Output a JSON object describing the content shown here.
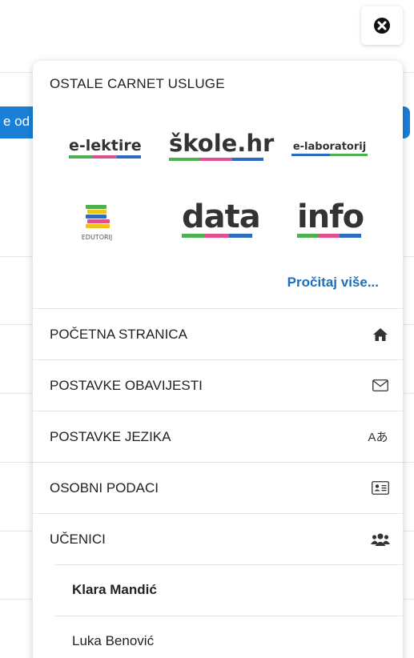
{
  "background": {
    "button_fragment": "e od"
  },
  "close_button": {
    "icon": "close-circle-icon"
  },
  "services": {
    "title": "OSTALE CARNET USLUGE",
    "logos": [
      "e-lektire",
      "škole.hr",
      "e-laboratorij",
      "EDUTORIJ",
      "data",
      "info"
    ],
    "read_more": "Pročitaj više..."
  },
  "menu": {
    "items": [
      {
        "label": "POČETNA STRANICA",
        "icon": "home-icon"
      },
      {
        "label": "POSTAVKE OBAVIJESTI",
        "icon": "envelope-icon"
      },
      {
        "label": "POSTAVKE JEZIKA",
        "icon": "translate-icon",
        "glyph": "Aあ"
      },
      {
        "label": "OSOBNI PODACI",
        "icon": "id-card-icon"
      },
      {
        "label": "UČENICI",
        "icon": "users-icon"
      }
    ]
  },
  "students": [
    {
      "name": "Klara Mandić",
      "active": true
    },
    {
      "name": "Luka Benović",
      "active": false
    }
  ],
  "colors": {
    "accent_blue": "#1a7fd6",
    "link_blue": "#1a6fc0",
    "stripe_green": "#4caf50",
    "stripe_pink": "#e0508c",
    "stripe_blue": "#2c6bbf",
    "stripe_yellow": "#f0c419"
  }
}
